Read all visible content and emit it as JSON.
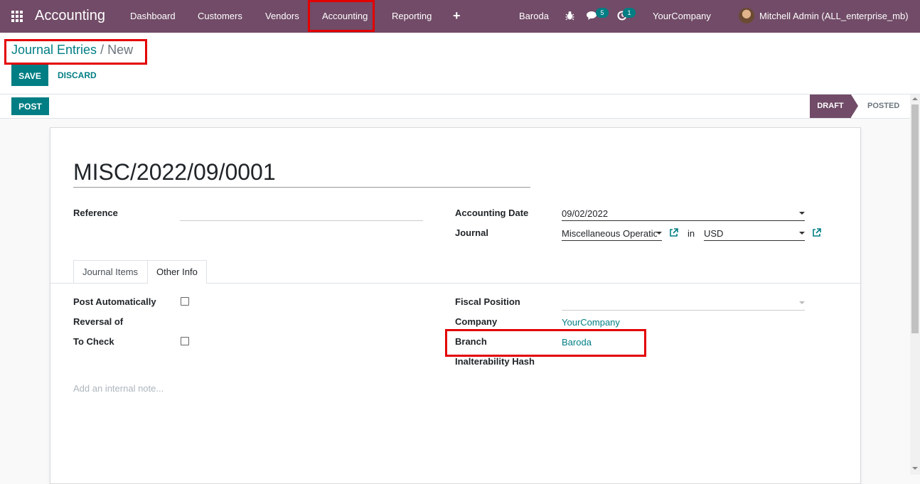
{
  "navbar": {
    "app_name": "Accounting",
    "menu": [
      "Dashboard",
      "Customers",
      "Vendors",
      "Accounting",
      "Reporting"
    ],
    "plus": "+",
    "branch": "Baroda",
    "messages_count": "5",
    "activities_count": "1",
    "company": "YourCompany",
    "user": "Mitchell Admin (ALL_enterprise_mb)",
    "icons": [
      "apps-icon",
      "bug-icon",
      "chat-icon",
      "clock-icon",
      "avatar"
    ]
  },
  "breadcrumb": {
    "parent": "Journal Entries",
    "separator": "/",
    "current": "New"
  },
  "buttons": {
    "save": "SAVE",
    "discard": "DISCARD",
    "post": "POST"
  },
  "status": {
    "draft": "DRAFT",
    "posted": "POSTED"
  },
  "form": {
    "name": "MISC/2022/09/0001",
    "reference_label": "Reference",
    "reference_value": "",
    "accounting_date_label": "Accounting Date",
    "accounting_date": "09/02/2022",
    "journal_label": "Journal",
    "journal": "Miscellaneous Operatio",
    "in": "in",
    "currency": "USD"
  },
  "tabs": [
    "Journal Items",
    "Other Info"
  ],
  "other_info": {
    "post_automatically": "Post Automatically",
    "reversal_of": "Reversal of",
    "to_check": "To Check",
    "fiscal_position": "Fiscal Position",
    "company_label": "Company",
    "company_value": "YourCompany",
    "branch_label": "Branch",
    "branch_value": "Baroda",
    "hash_label": "Inalterability Hash",
    "note_placeholder": "Add an internal note..."
  },
  "colors": {
    "navbar": "#714B67",
    "primary": "#017e84",
    "highlight": "#e30000"
  }
}
